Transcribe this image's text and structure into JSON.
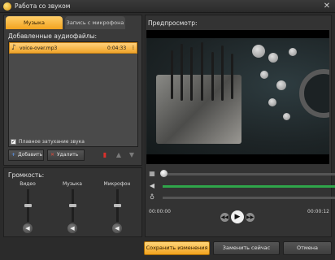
{
  "window": {
    "title": "Работа со звуком",
    "close_glyph": "✕"
  },
  "tabs": [
    {
      "label": "Музыка",
      "active": true
    },
    {
      "label": "Запись с микрофона",
      "active": false
    }
  ],
  "audio_files": {
    "heading": "Добавленные аудиофайлы:",
    "items": [
      {
        "name": "voice-over.mp3",
        "duration": "0:04:33",
        "selected": true
      }
    ]
  },
  "fade": {
    "label": "Плавное затухание звука",
    "checked": true
  },
  "buttons": {
    "add": "Добавить",
    "delete": "Удалить"
  },
  "volume": {
    "heading": "Громкость:",
    "channels": [
      {
        "label": "Видео",
        "level": 0.5
      },
      {
        "label": "Музыка",
        "level": 0.5
      },
      {
        "label": "Микрофон",
        "level": 0.5
      }
    ]
  },
  "preview": {
    "heading": "Предпросмотр:",
    "time_start": "00:00:00",
    "time_end": "00:00:12"
  },
  "footer": {
    "save": "Сохранить изменения",
    "replace": "Заменить сейчас",
    "cancel": "Отмена"
  },
  "colors": {
    "accent": "#f2a31f",
    "audio_track": "#2fa64a"
  }
}
